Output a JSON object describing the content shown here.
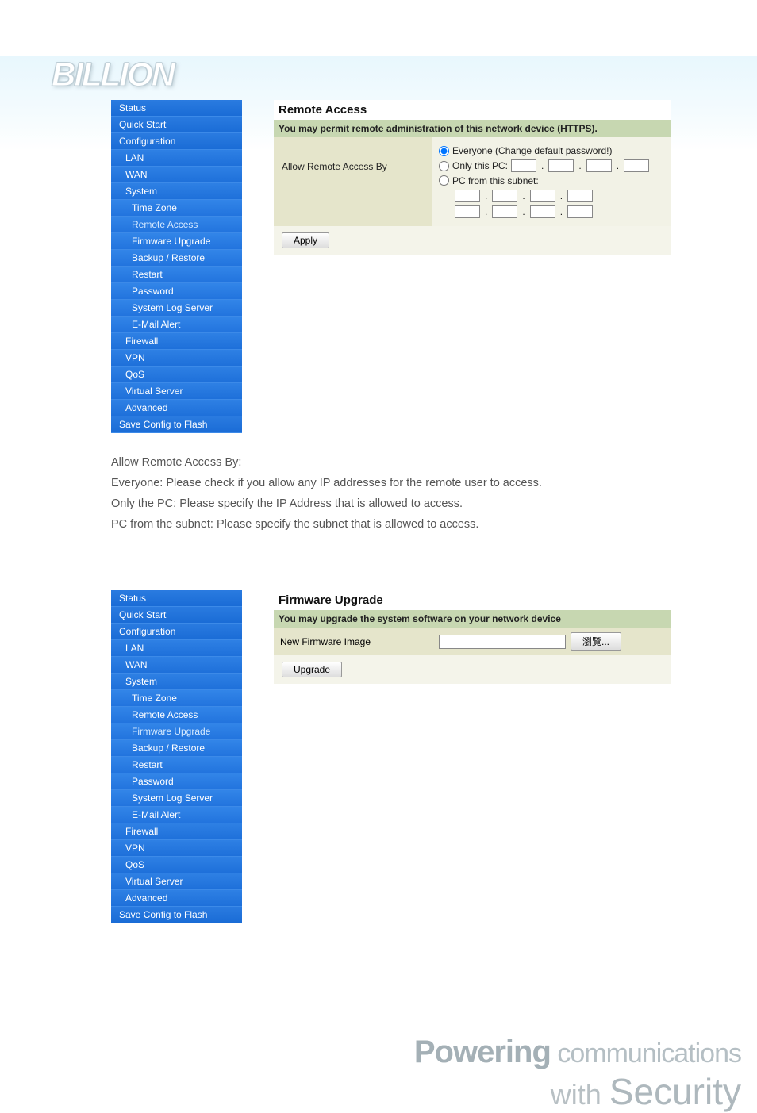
{
  "logo_text": "BILLION",
  "sidebar": {
    "items": [
      {
        "label": "Status",
        "level": 1
      },
      {
        "label": "Quick Start",
        "level": 1
      },
      {
        "label": "Configuration",
        "level": 1
      },
      {
        "label": "LAN",
        "level": 2
      },
      {
        "label": "WAN",
        "level": 2
      },
      {
        "label": "System",
        "level": 2
      },
      {
        "label": "Time Zone",
        "level": 3
      },
      {
        "label": "Remote Access",
        "level": 3
      },
      {
        "label": "Firmware Upgrade",
        "level": 3
      },
      {
        "label": "Backup / Restore",
        "level": 3
      },
      {
        "label": "Restart",
        "level": 3
      },
      {
        "label": "Password",
        "level": 3
      },
      {
        "label": "System Log Server",
        "level": 3
      },
      {
        "label": "E-Mail Alert",
        "level": 3
      },
      {
        "label": "Firewall",
        "level": 2
      },
      {
        "label": "VPN",
        "level": 2
      },
      {
        "label": "QoS",
        "level": 2
      },
      {
        "label": "Virtual Server",
        "level": 2
      },
      {
        "label": "Advanced",
        "level": 2
      },
      {
        "label": "Save Config to Flash",
        "level": 1
      }
    ]
  },
  "remote_access": {
    "title": "Remote Access",
    "subtitle": "You may permit remote administration of this network device (HTTPS).",
    "row_label": "Allow Remote Access By",
    "opt_everyone": "Everyone (Change default password!)",
    "opt_onlypc": "Only this PC:",
    "opt_subnet": "PC from this subnet:",
    "apply": "Apply"
  },
  "descriptions": {
    "heading": "Allow Remote Access By:",
    "d1": "Everyone: Please check if you allow any IP addresses for the remote user to access.",
    "d2": "Only the PC: Please specify the IP Address that is allowed to access.",
    "d3": "PC from the subnet: Please specify the subnet that is allowed to access."
  },
  "firmware": {
    "title": "Firmware Upgrade",
    "subtitle": "You may upgrade the system software on your network device",
    "row_label": "New Firmware Image",
    "browse": "瀏覽...",
    "upgrade": "Upgrade"
  },
  "footer": {
    "powering": "Powering",
    "comm": "communications",
    "with": "with",
    "security": "Security"
  }
}
